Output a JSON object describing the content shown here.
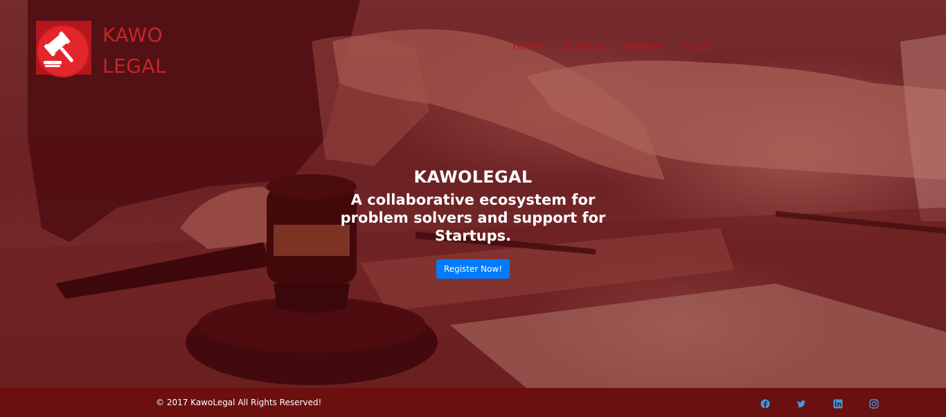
{
  "brand": {
    "line1": "KAWO",
    "line2": "LEGAL",
    "logo_icon": "gavel-icon",
    "color": "#c6262a"
  },
  "nav": {
    "items": [
      {
        "label": "Home"
      },
      {
        "label": "Startup"
      },
      {
        "label": "Register"
      },
      {
        "label": "Login"
      }
    ],
    "color": "#b3161d"
  },
  "hero": {
    "title": "KAWOLEGAL",
    "subtitle": "A collaborative ecosystem for problem solvers and support for Startups.",
    "cta_label": "Register Now!",
    "cta_color": "#007bff",
    "overlay_color": "#6e1216"
  },
  "footer": {
    "copyright": "© 2017 KawoLegal All Rights Reserved!",
    "background": "#6b0f0f",
    "social": [
      {
        "icon": "facebook-icon"
      },
      {
        "icon": "twitter-icon"
      },
      {
        "icon": "linkedin-icon"
      },
      {
        "icon": "instagram-icon"
      }
    ],
    "social_color": "#3a9ce8"
  }
}
